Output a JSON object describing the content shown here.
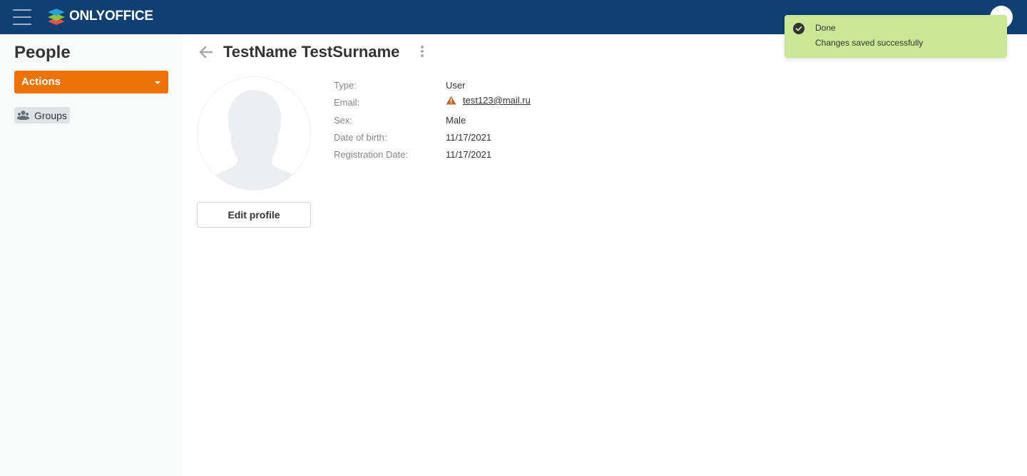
{
  "header": {
    "brand": "ONLYOFFICE",
    "menu_icon": "hamburger-icon",
    "logo_icon": "onlyoffice-logo-icon",
    "avatar_icon": "user-avatar-icon",
    "colors": {
      "background": "#0f4071"
    }
  },
  "sidebar": {
    "title": "People",
    "actions_label": "Actions",
    "actions_icon": "caret-down-icon",
    "items": [
      {
        "label": "Groups",
        "icon": "groups-icon"
      }
    ],
    "colors": {
      "accent": "#ed7309"
    }
  },
  "profile": {
    "back_icon": "arrow-left-icon",
    "more_icon": "vertical-dots-icon",
    "name": "TestName TestSurname",
    "edit_button": "Edit profile",
    "fields": [
      {
        "label": "Type:",
        "value": "User"
      },
      {
        "label": "Email:",
        "value": "test123@mail.ru",
        "icon": "warning-icon"
      },
      {
        "label": "Sex:",
        "value": "Male"
      },
      {
        "label": "Date of birth:",
        "value": "11/17/2021"
      },
      {
        "label": "Registration Date:",
        "value": "11/17/2021"
      }
    ]
  },
  "toast": {
    "icon": "check-circle-icon",
    "title": "Done",
    "message": "Changes saved successfully",
    "colors": {
      "background": "#cae796"
    }
  }
}
